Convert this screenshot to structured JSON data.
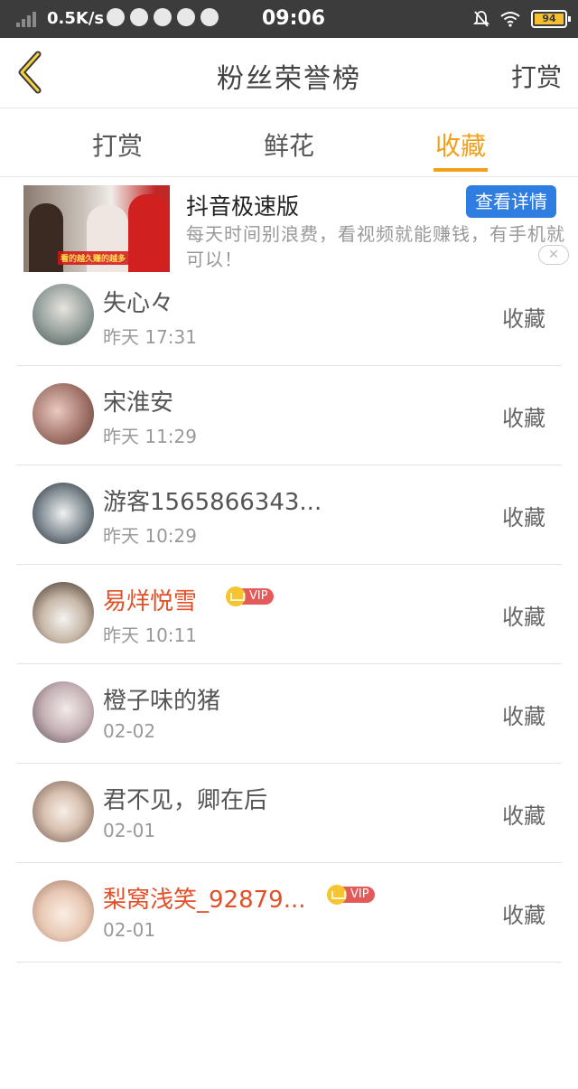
{
  "status_bar": {
    "speed": "0.5K/s",
    "time": "09:06",
    "battery": "94",
    "icons": [
      "signal-icon",
      "notification-icons",
      "bell-muted-icon",
      "wifi-icon",
      "battery-icon"
    ]
  },
  "nav": {
    "title": "粉丝荣誉榜",
    "action": "打赏"
  },
  "tabs": [
    {
      "label": "打赏",
      "active": false
    },
    {
      "label": "鲜花",
      "active": false
    },
    {
      "label": "收藏",
      "active": true
    }
  ],
  "ad": {
    "title": "抖音极速版",
    "button": "查看详情",
    "description": "每天时间别浪费，看视频就能赚钱，有手机就可以！",
    "thumb_caption": "看的越久赚的越多",
    "close": "✕"
  },
  "fans": [
    {
      "name": "失心々",
      "time": "昨天 17:31",
      "type": "收藏",
      "vip": false,
      "vip_label": ""
    },
    {
      "name": "宋淮安",
      "time": "昨天 11:29",
      "type": "收藏",
      "vip": false,
      "vip_label": ""
    },
    {
      "name": "游客1565866343...",
      "time": "昨天 10:29",
      "type": "收藏",
      "vip": false,
      "vip_label": ""
    },
    {
      "name": "易烊悦雪",
      "time": "昨天 10:11",
      "type": "收藏",
      "vip": true,
      "vip_label": "VIP"
    },
    {
      "name": "橙子味的猪",
      "time": "02-02",
      "type": "收藏",
      "vip": false,
      "vip_label": ""
    },
    {
      "name": "君不见，卿在后",
      "time": "02-01",
      "type": "收藏",
      "vip": false,
      "vip_label": ""
    },
    {
      "name": "梨窝浅笑_92879...",
      "time": "02-01",
      "type": "收藏",
      "vip": true,
      "vip_label": "VIP"
    }
  ],
  "colors": {
    "accent": "#f2a01c",
    "vip_name": "#e2502a",
    "ad_button": "#2f7de0",
    "status_bar": "#3c3c3c"
  }
}
